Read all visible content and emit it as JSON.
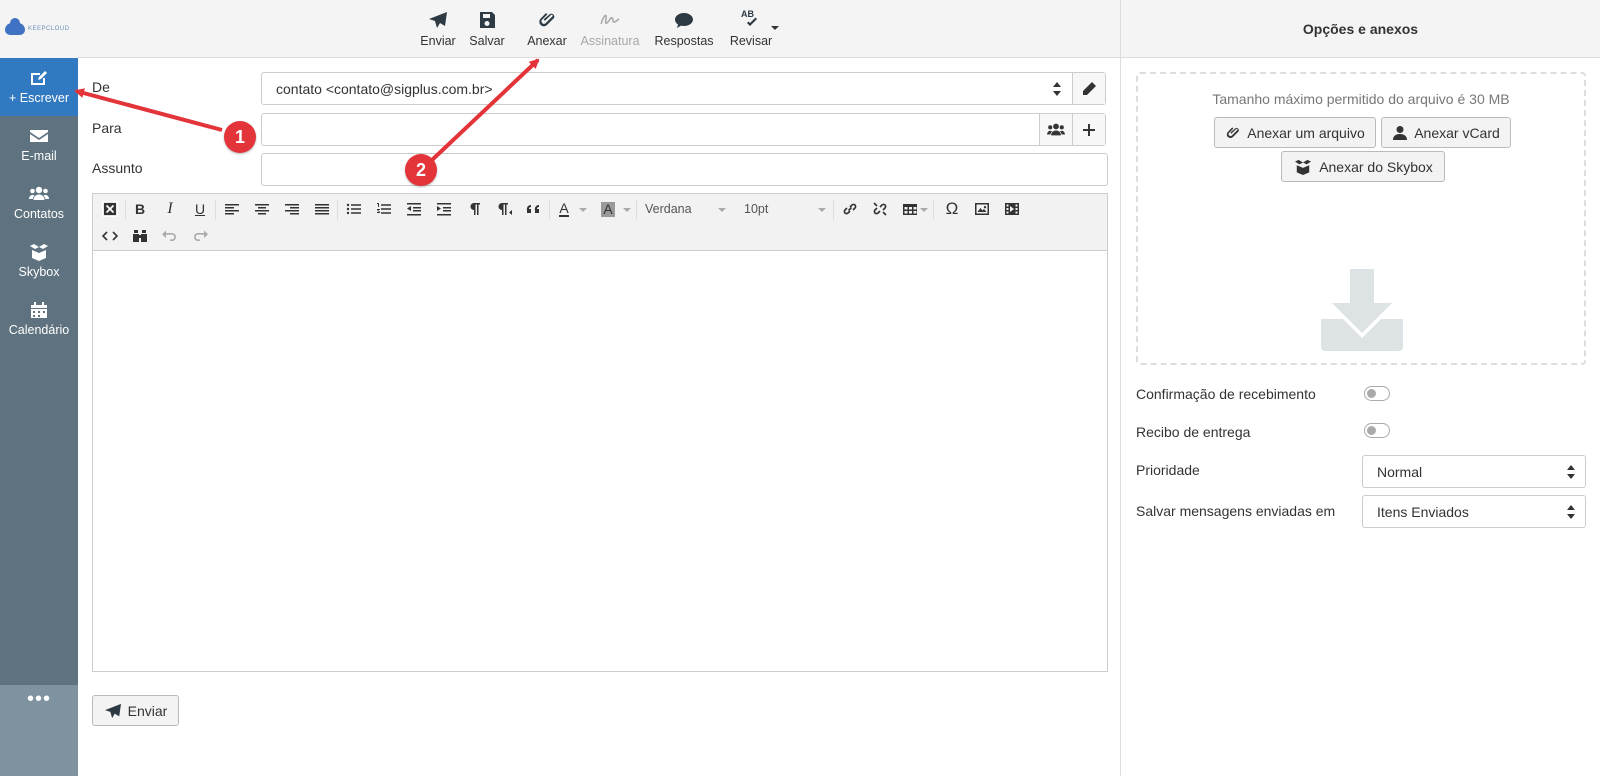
{
  "sidebar": {
    "logo_text": "KEEPCLOUD",
    "items": [
      {
        "label": "+ Escrever",
        "icon": "compose-icon",
        "active": true
      },
      {
        "label": "E-mail",
        "icon": "envelope-icon"
      },
      {
        "label": "Contatos",
        "icon": "users-icon"
      },
      {
        "label": "Skybox",
        "icon": "box-icon"
      },
      {
        "label": "Calendário",
        "icon": "calendar-icon"
      }
    ],
    "more": "•••"
  },
  "toolbar": {
    "send": "Enviar",
    "save": "Salvar",
    "attach": "Anexar",
    "signature": "Assinatura",
    "responses": "Respostas",
    "review": "Revisar",
    "review_icon_text": "AB"
  },
  "compose": {
    "from_label": "De",
    "from_value": "contato <contato@sigplus.com.br>",
    "to_label": "Para",
    "to_value": "",
    "subject_label": "Assunto",
    "subject_value": ""
  },
  "editor": {
    "font_family": "Verdana",
    "font_size": "10pt"
  },
  "send_button": "Enviar",
  "panel": {
    "title": "Opções e anexos",
    "max_size_note": "Tamanho máximo permitido do arquivo é 30 MB",
    "attach_file": "Anexar um arquivo",
    "attach_vcard": "Anexar vCard",
    "attach_skybox": "Anexar do Skybox",
    "read_receipt_label": "Confirmação de recebimento",
    "read_receipt_on": false,
    "delivery_receipt_label": "Recibo de entrega",
    "delivery_receipt_on": false,
    "priority_label": "Prioridade",
    "priority_value": "Normal",
    "save_sent_label": "Salvar mensagens enviadas em",
    "save_sent_value": "Itens Enviados"
  },
  "annotations": {
    "step1": "1",
    "step2": "2",
    "color": "#e3343a"
  },
  "colors": {
    "accent": "#3179c1",
    "sidebar": "#5e727f"
  }
}
